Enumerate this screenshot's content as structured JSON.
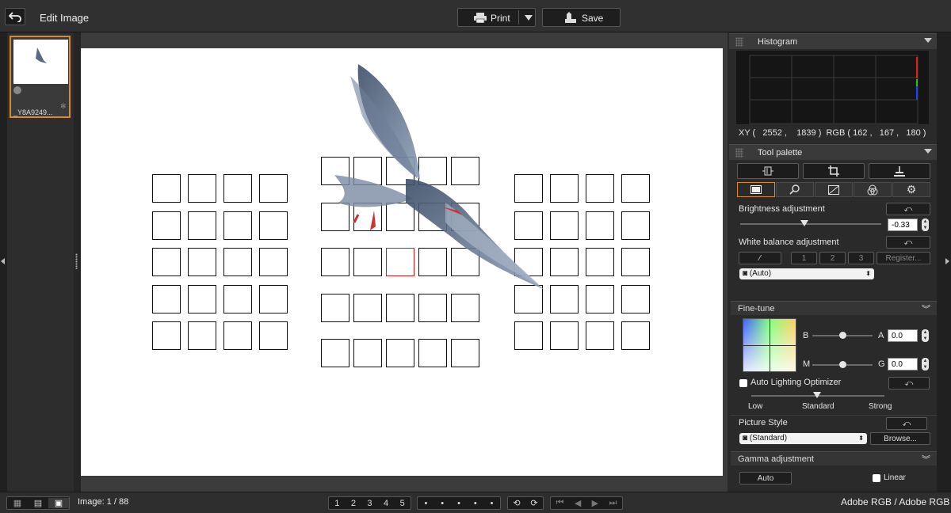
{
  "header": {
    "title": "Edit Image",
    "print_label": "Print",
    "save_label": "Save"
  },
  "thumbnail": {
    "filename": "_Y8A9249..."
  },
  "histogram": {
    "title": "Histogram",
    "xy_readout": "XY (   2552 ,    1839 )  RGB ( 162 ,   167 ,   180 )"
  },
  "tool_palette": {
    "title": "Tool palette",
    "brightness": {
      "label": "Brightness adjustment",
      "value": "-0.33"
    },
    "white_balance": {
      "label": "White balance adjustment",
      "presets": [
        "1",
        "2",
        "3"
      ],
      "register_label": "Register...",
      "selected": "(Auto)"
    },
    "fine_tune": {
      "title": "Fine-tune",
      "b_label": "B",
      "a_label": "A",
      "a_value": "0.0",
      "m_label": "M",
      "g_label": "G",
      "g_value": "0.0"
    },
    "auto_lighting": {
      "label": "Auto Lighting Optimizer",
      "checked": false,
      "levels": [
        "Low",
        "Standard",
        "Strong"
      ],
      "selected_level": "Standard"
    },
    "picture_style": {
      "label": "Picture Style",
      "selected": "(Standard)",
      "browse_label": "Browse..."
    },
    "gamma": {
      "title": "Gamma adjustment",
      "auto_label": "Auto",
      "linear_label": "Linear",
      "linear_checked": false
    }
  },
  "footer": {
    "image_counter": "Image: 1 / 88",
    "rating_buttons": [
      "1",
      "2",
      "3",
      "4",
      "5"
    ],
    "color_space": "Adobe RGB / Adobe RGB"
  },
  "colors": {
    "accent": "#d98a2b",
    "af_selected": "#d01818"
  }
}
